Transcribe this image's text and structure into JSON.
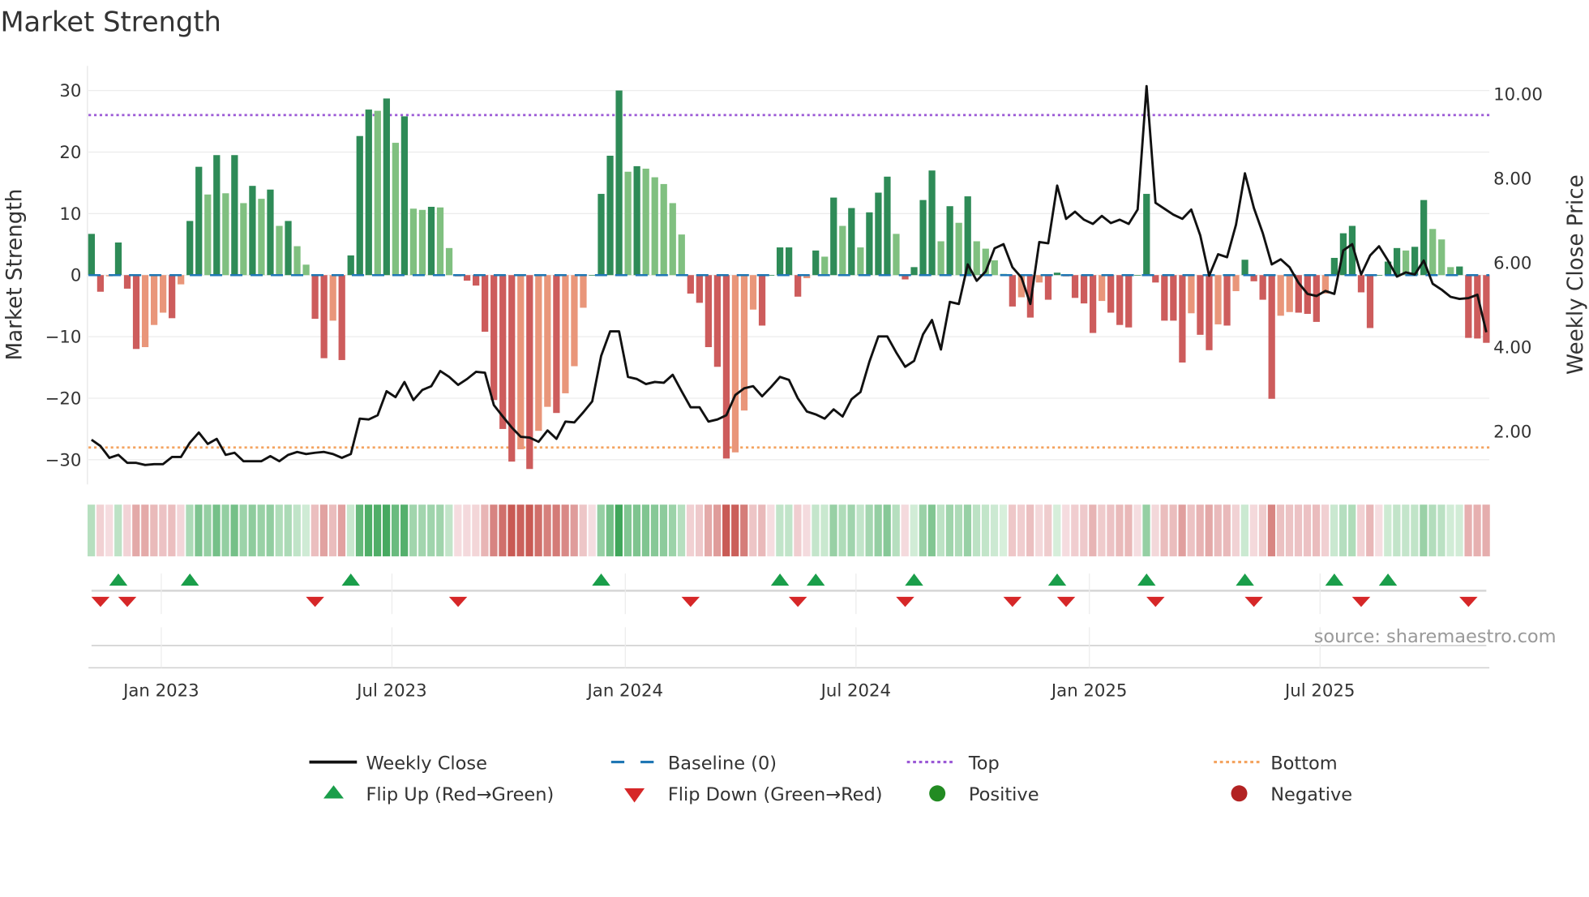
{
  "chart_data": {
    "type": "bar",
    "title": "Market Strength",
    "ylabel": "Market Strength",
    "y2label": "Weekly Close Price",
    "ylim": [
      -34,
      34
    ],
    "y2lim": [
      0.72,
      10.65
    ],
    "yticks": [
      30,
      20,
      10,
      0,
      -10,
      -20,
      -30
    ],
    "yticks_labels": [
      "30",
      "20",
      "10",
      "0",
      "−10",
      "−20",
      "−30"
    ],
    "y2ticks": [
      10,
      8,
      6,
      4,
      2
    ],
    "y2ticks_labels": [
      "10.00",
      "8.00",
      "6.00",
      "4.00",
      "2.00"
    ],
    "top_level": 26,
    "bottom_level": -28,
    "baseline": 0,
    "x_ticks": [
      {
        "label": "Jan 2023",
        "week": 7.8
      },
      {
        "label": "Jul 2023",
        "week": 33.6
      },
      {
        "label": "Jan 2024",
        "week": 59.7
      },
      {
        "label": "Jul 2024",
        "week": 85.5
      },
      {
        "label": "Jan 2025",
        "week": 111.6
      },
      {
        "label": "Jul 2025",
        "week": 137.4
      }
    ],
    "strength": [
      6.7,
      -2.7,
      -0.2,
      5.3,
      -2.2,
      -12,
      -11.7,
      -8.1,
      -6.1,
      -7,
      -1.5,
      8.8,
      17.6,
      13.1,
      19.5,
      13.3,
      19.5,
      11.7,
      14.5,
      12.4,
      13.9,
      8,
      8.8,
      4.7,
      1.7,
      -7.1,
      -13.5,
      -7.4,
      -13.8,
      3.2,
      22.6,
      26.9,
      26.7,
      28.7,
      21.5,
      25.8,
      10.8,
      10.6,
      11.1,
      11,
      4.4,
      -0.2,
      -0.9,
      -1.7,
      -9.2,
      -20.3,
      -25,
      -30.3,
      -28.3,
      -31.5,
      -25.3,
      -21.4,
      -22.4,
      -19.2,
      -14.8,
      -5.3,
      0,
      13.2,
      19.4,
      30,
      16.8,
      17.7,
      17.3,
      15.9,
      14.8,
      11.7,
      6.6,
      -3,
      -4.5,
      -11.7,
      -14.9,
      -29.8,
      -28.8,
      -22,
      -5.6,
      -8.2,
      0,
      4.5,
      4.5,
      -3.5,
      -0.5,
      4,
      3,
      12.6,
      8,
      10.9,
      4.5,
      10.2,
      13.4,
      16,
      6.7,
      -0.7,
      1.3,
      12.2,
      17,
      5.5,
      11.2,
      8.5,
      12.8,
      5.5,
      4.3,
      2.4,
      0.2,
      -5.1,
      -3.6,
      -6.9,
      -1.2,
      -4,
      0.4,
      -0.2,
      -3.7,
      -4.6,
      -9.4,
      -4.2,
      -6.1,
      -8.1,
      -8.5,
      0,
      13.2,
      -1.2,
      -7.4,
      -7.4,
      -14.2,
      -6.2,
      -9.7,
      -12.2,
      -8,
      -8.2,
      -2.6,
      2.5,
      -1,
      -4,
      -20.1,
      -6.6,
      -6,
      -6.1,
      -6.3,
      -7.6,
      -3,
      2.8,
      6.8,
      8,
      -2.8,
      -8.6,
      0,
      2.2,
      4.4,
      4,
      4.6,
      12.2,
      7.5,
      5.8,
      1.3,
      1.4,
      -10.2,
      -10.3,
      -11
    ],
    "weekly_close": [
      1.78,
      1.63,
      1.35,
      1.42,
      1.23,
      1.23,
      1.18,
      1.2,
      1.2,
      1.37,
      1.37,
      1.71,
      1.95,
      1.68,
      1.8,
      1.42,
      1.47,
      1.27,
      1.27,
      1.27,
      1.39,
      1.27,
      1.42,
      1.49,
      1.44,
      1.47,
      1.49,
      1.44,
      1.35,
      1.44,
      2.28,
      2.26,
      2.36,
      2.93,
      2.79,
      3.15,
      2.72,
      2.96,
      3.05,
      3.41,
      3.27,
      3.08,
      3.22,
      3.39,
      3.37,
      2.6,
      2.33,
      2.07,
      1.85,
      1.83,
      1.73,
      2.0,
      1.8,
      2.21,
      2.19,
      2.43,
      2.69,
      3.77,
      4.35,
      4.35,
      3.27,
      3.22,
      3.1,
      3.15,
      3.13,
      3.32,
      2.93,
      2.55,
      2.55,
      2.21,
      2.26,
      2.36,
      2.84,
      3.0,
      3.05,
      2.81,
      3.03,
      3.27,
      3.2,
      2.76,
      2.45,
      2.38,
      2.28,
      2.5,
      2.33,
      2.74,
      2.91,
      3.63,
      4.23,
      4.23,
      3.85,
      3.51,
      3.65,
      4.28,
      4.62,
      3.92,
      5.05,
      5.0,
      5.94,
      5.55,
      5.77,
      6.32,
      6.42,
      5.87,
      5.63,
      5.0,
      6.47,
      6.44,
      7.81,
      7.02,
      7.19,
      7.0,
      6.9,
      7.09,
      6.92,
      7.0,
      6.9,
      7.24,
      10.17,
      7.4,
      7.26,
      7.12,
      7.02,
      7.24,
      6.63,
      5.67,
      6.18,
      6.11,
      6.88,
      8.1,
      7.28,
      6.68,
      5.94,
      6.06,
      5.87,
      5.5,
      5.24,
      5.19,
      5.31,
      5.24,
      6.27,
      6.42,
      5.7,
      6.15,
      6.37,
      6.03,
      5.65,
      5.75,
      5.7,
      6.03,
      5.48,
      5.34,
      5.17,
      5.12,
      5.14,
      5.22,
      4.33
    ],
    "legend": {
      "placement": "bottom-center",
      "items": [
        {
          "label": "Weekly Close",
          "kind": "line"
        },
        {
          "label": "Baseline (0)",
          "kind": "dash"
        },
        {
          "label": "Top",
          "kind": "dot-top"
        },
        {
          "label": "Bottom",
          "kind": "dot-bottom"
        },
        {
          "label": "Flip Up (Red→Green)",
          "kind": "tri-up"
        },
        {
          "label": "Flip Down (Green→Red)",
          "kind": "tri-down"
        },
        {
          "label": "Positive",
          "kind": "circle-pos"
        },
        {
          "label": "Negative",
          "kind": "circle-neg"
        }
      ]
    },
    "source": "source: sharemaestro.com",
    "grid": true
  },
  "colors": {
    "pos_dark": "#2e8b57",
    "pos_light": "#80c080",
    "neg_dark": "#cd5c5c",
    "neg_light": "#e9967a",
    "close": "#111111",
    "baseline": "#1f77b4",
    "top": "#9b59d6",
    "bottom": "#f4a460",
    "flip_up": "#1a9e4a",
    "flip_down": "#d62728",
    "positive": "#228b22",
    "negative": "#b22222"
  }
}
